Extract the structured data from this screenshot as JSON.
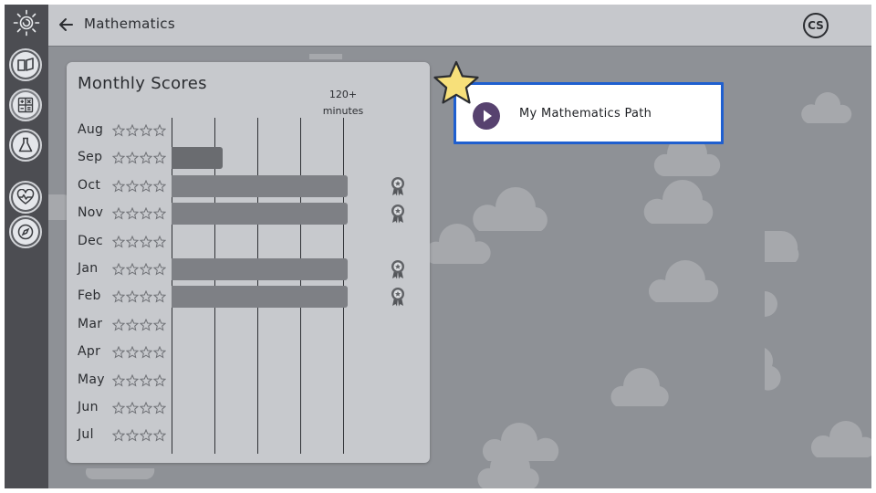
{
  "header": {
    "title": "Mathematics",
    "back_icon": "arrow-left-icon",
    "user_initials": "CS"
  },
  "sidebar": {
    "logo_icon": "sun-swirl-logo",
    "items": [
      {
        "icon": "open-book-icon",
        "label": "",
        "active": false
      },
      {
        "icon": "calculator-icon",
        "label": "",
        "active": true
      },
      {
        "icon": "flask-icon",
        "label": "",
        "active": false
      },
      {
        "icon": "heart-pulse-icon",
        "label": "",
        "active": false
      },
      {
        "icon": "compass-icon",
        "label": "",
        "active": false
      }
    ]
  },
  "scores_card": {
    "title": "Monthly Scores",
    "legend_line1": "120+",
    "legend_line2": "minutes",
    "max_minutes": 120,
    "rows": [
      {
        "month": "Aug",
        "minutes": 0,
        "stars": 0,
        "badge": false
      },
      {
        "month": "Sep",
        "minutes": 35,
        "stars": 0,
        "badge": false
      },
      {
        "month": "Oct",
        "minutes": 120,
        "stars": 0,
        "badge": true
      },
      {
        "month": "Nov",
        "minutes": 120,
        "stars": 0,
        "badge": true
      },
      {
        "month": "Dec",
        "minutes": 0,
        "stars": 0,
        "badge": false
      },
      {
        "month": "Jan",
        "minutes": 120,
        "stars": 0,
        "badge": true
      },
      {
        "month": "Feb",
        "minutes": 120,
        "stars": 0,
        "badge": true
      },
      {
        "month": "Mar",
        "minutes": 0,
        "stars": 0,
        "badge": false
      },
      {
        "month": "Apr",
        "minutes": 0,
        "stars": 0,
        "badge": false
      },
      {
        "month": "May",
        "minutes": 0,
        "stars": 0,
        "badge": false
      },
      {
        "month": "Jun",
        "minutes": 0,
        "stars": 0,
        "badge": false
      },
      {
        "month": "Jul",
        "minutes": 0,
        "stars": 0,
        "badge": false
      }
    ]
  },
  "path_card": {
    "label": "My Mathematics Path",
    "play_icon": "play-icon",
    "star_icon": "star-icon"
  },
  "colors": {
    "accent_blue": "#1f5fcf",
    "play_purple": "#57426f",
    "star_yellow": "#f7e07a",
    "background": "#8e9196"
  }
}
